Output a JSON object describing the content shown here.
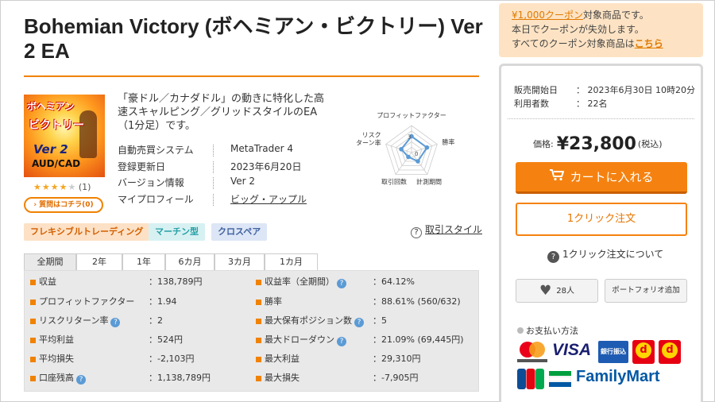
{
  "product": {
    "title": "Bohemian Victory (ボヘミアン・ビクトリー) Ver 2 EA",
    "thumb": {
      "line1": "ボヘミアン",
      "line2": "ビクトリー",
      "line3": "Ver 2",
      "line4": "AUD/CAD"
    },
    "rating": {
      "stars_filled": 4,
      "stars_total": 5,
      "count": "(1)"
    },
    "qa_button": "質問はコチラ(0)",
    "description": "「豪ドル／カナダドル」の動きに特化した高速スキャルピング／グリッドスタイルのEA（1分足）です。",
    "specs": [
      {
        "label": "自動売買システム",
        "value": "MetaTrader 4"
      },
      {
        "label": "登録更新日",
        "value": "2023年6月20日"
      },
      {
        "label": "バージョン情報",
        "value": "Ver 2"
      },
      {
        "label": "マイプロフィール",
        "value": "ビッグ・アップル"
      }
    ],
    "tags": [
      "フレキシブルトレーディング",
      "マーチン型",
      "クロスペア"
    ],
    "howto_link": "取引スタイル"
  },
  "radar": {
    "axes": [
      "プロフィットファクター",
      "勝率",
      "計測期間",
      "取引回数",
      "リスクリターン率"
    ],
    "axis_label_lines": {
      "4": [
        "リスク",
        "ターン率"
      ]
    },
    "tick_labels": [
      "0",
      "3"
    ],
    "scale_max": 5,
    "values": [
      3,
      3,
      2,
      1,
      2
    ],
    "color": "#5b9bd5"
  },
  "stats": {
    "tabs": [
      "全期間",
      "2年",
      "1年",
      "6カ月",
      "3カ月",
      "1カ月"
    ],
    "active_tab": 0,
    "left": [
      {
        "label": "収益",
        "value": "138,789円",
        "help": false
      },
      {
        "label": "プロフィットファクター",
        "value": "1.94",
        "help": false
      },
      {
        "label": "リスクリターン率",
        "value": "2",
        "help": true
      },
      {
        "label": "平均利益",
        "value": "524円",
        "help": false
      },
      {
        "label": "平均損失",
        "value": "-2,103円",
        "help": false
      },
      {
        "label": "口座残高",
        "value": "1,138,789円",
        "help": true
      }
    ],
    "right": [
      {
        "label": "収益率（全期間）",
        "value": "64.12%",
        "help": true
      },
      {
        "label": "勝率",
        "value": "88.61% (560/632)",
        "help": false
      },
      {
        "label": "最大保有ポジション数",
        "value": "5",
        "help": true
      },
      {
        "label": "最大ドローダウン",
        "value": "21.09% (69,445円)",
        "help": true
      },
      {
        "label": "最大利益",
        "value": "29,310円",
        "help": false
      },
      {
        "label": "最大損失",
        "value": "-7,905円",
        "help": false
      }
    ]
  },
  "coupon": {
    "coupon_link": "¥1,000クーポン",
    "line1_rest": "対象商品です。",
    "line2": "本日でクーポンが失効します。",
    "line3": "すべてのクーポン対象商品は",
    "line3_link": "こちら"
  },
  "purchase": {
    "sale_start_label": "販売開始日",
    "sale_start_value": "：  2023年6月30日 10時20分",
    "users_label": "利用者数",
    "users_value": "：  22名",
    "price_label": "価格:",
    "price_value": "¥23,800",
    "tax_label": "(税込)",
    "cart_button": "カートに入れる",
    "one_click_button": "1クリック注文",
    "one_click_about": "1クリック注文について",
    "fav_count": "28人",
    "portfolio_button": "ポートフォリオ追加",
    "payment_heading": "お支払い方法",
    "payment": {
      "visa": "VISA",
      "bank": "銀行振込",
      "dpay": "d",
      "familymart": "FamilyMart"
    }
  },
  "colors": {
    "accent": "#f08200",
    "cart": "#f58210",
    "radar": "#5b9bd5",
    "coupon_bg": "#fde3c4"
  }
}
